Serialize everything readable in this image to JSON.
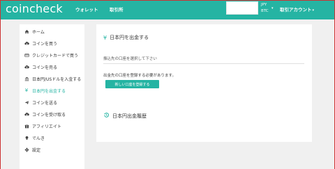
{
  "header": {
    "logo": "coincheck",
    "nav": {
      "wallet": "ウォレット",
      "exchange": "取引所"
    },
    "balance": {
      "jpy_label": "JPY",
      "btc_label": "BTC"
    },
    "account_menu": "取引アカウント"
  },
  "sidebar": {
    "items": [
      {
        "label": "ホーム",
        "icon": "home-icon"
      },
      {
        "label": "コインを買う",
        "icon": "cloud-download-icon"
      },
      {
        "label": "クレジットカードで買う",
        "icon": "credit-card-icon"
      },
      {
        "label": "コインを売る",
        "icon": "cloud-upload-icon"
      },
      {
        "label": "日本円/USドルを入金する",
        "icon": "bank-icon"
      },
      {
        "label": "日本円を出金する",
        "icon": "yen-icon",
        "active": true
      },
      {
        "label": "コインを送る",
        "icon": "paper-plane-icon"
      },
      {
        "label": "コインを受け取る",
        "icon": "cloud-download-icon"
      },
      {
        "label": "アフィリエイト",
        "icon": "gift-icon"
      },
      {
        "label": "でんき",
        "icon": "lightbulb-icon"
      },
      {
        "label": "設定",
        "icon": "gear-icon"
      }
    ]
  },
  "main": {
    "title": "日本円を出金する",
    "select_prompt": "振込先の口座を選択して下さい",
    "notice": "出金先の口座を登録する必要があります。",
    "register_button": "新しい口座を登録する",
    "history_title": "日本円出金履歴"
  },
  "colors": {
    "accent": "#25b4a3",
    "frame": "#cc3333",
    "background": "#f0f0f0"
  }
}
